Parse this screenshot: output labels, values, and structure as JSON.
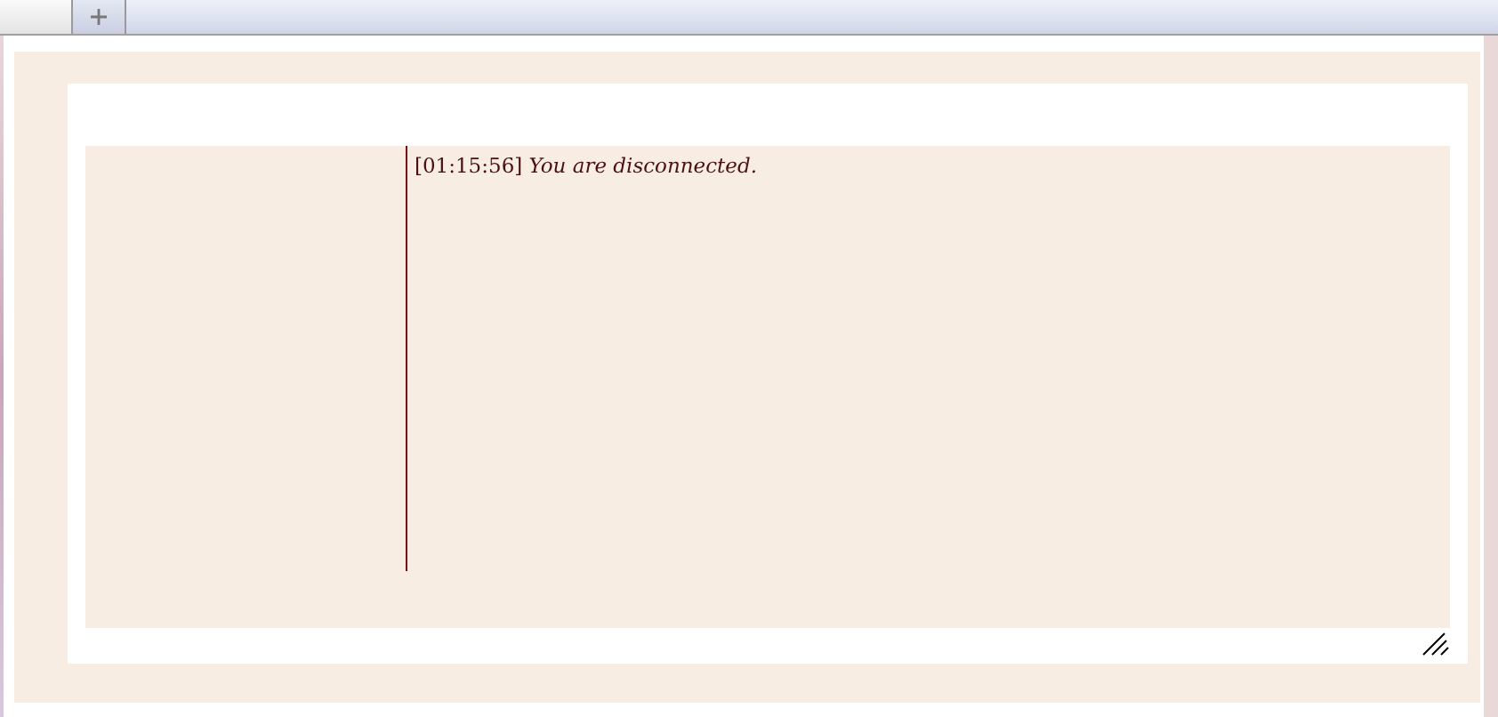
{
  "log": [
    {
      "time": "[01:15:56]",
      "message": "You are disconnected."
    }
  ]
}
